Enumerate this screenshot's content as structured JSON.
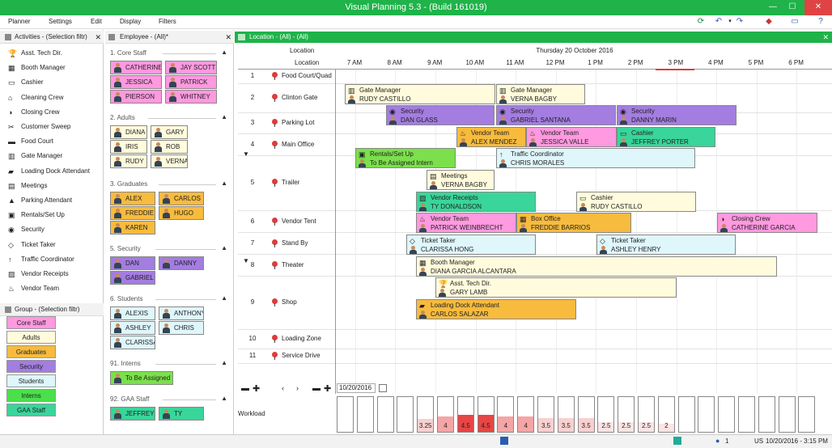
{
  "app": {
    "title": "Visual Planning 5.3 - (Build 161019)"
  },
  "menu": [
    "Planner",
    "Settings",
    "Edit",
    "Display",
    "Filters"
  ],
  "activities": {
    "header": "Activities - (Selection filtr)",
    "items": [
      {
        "label": "Asst. Tech Dir.",
        "icon": "trophy-icon",
        "glyph": "🏆"
      },
      {
        "label": "Booth Manager",
        "icon": "booth-icon",
        "glyph": "▦"
      },
      {
        "label": "Cashier",
        "icon": "cashier-icon",
        "glyph": "▭"
      },
      {
        "label": "Cleaning Crew",
        "icon": "broom-icon",
        "glyph": "⌂"
      },
      {
        "label": "Closing Crew",
        "icon": "closing-icon",
        "glyph": "◑"
      },
      {
        "label": "Customer Sweep",
        "icon": "sweep-icon",
        "glyph": "✂"
      },
      {
        "label": "Food Court",
        "icon": "food-icon",
        "glyph": "▬"
      },
      {
        "label": "Gate Manager",
        "icon": "gate-icon",
        "glyph": "▥"
      },
      {
        "label": "Loading Dock Attendant",
        "icon": "truck-icon",
        "glyph": "▰"
      },
      {
        "label": "Meetings",
        "icon": "meeting-icon",
        "glyph": "▤"
      },
      {
        "label": "Parking Attendant",
        "icon": "cone-icon",
        "glyph": "▲"
      },
      {
        "label": "Rentals/Set Up",
        "icon": "rentals-icon",
        "glyph": "▣"
      },
      {
        "label": "Security",
        "icon": "eye-icon",
        "glyph": "◉"
      },
      {
        "label": "Ticket Taker",
        "icon": "ticket-icon",
        "glyph": "◇"
      },
      {
        "label": "Traffic Coordinator",
        "icon": "traffic-icon",
        "glyph": "↑"
      },
      {
        "label": "Vendor Receipts",
        "icon": "receipt-icon",
        "glyph": "▨"
      },
      {
        "label": "Vendor Team",
        "icon": "vendor-icon",
        "glyph": "♨"
      }
    ]
  },
  "groups": {
    "header": "Group - (Selection filtr)",
    "items": [
      {
        "label": "Core Staff",
        "color": "#ff99e0"
      },
      {
        "label": "Adults",
        "color": "#fffbdc"
      },
      {
        "label": "Graduates",
        "color": "#f7bb3e"
      },
      {
        "label": "Security",
        "color": "#a37de0"
      },
      {
        "label": "Students",
        "color": "#dff6fb"
      },
      {
        "label": "Interns",
        "color": "#4be04b"
      },
      {
        "label": "GAA Staff",
        "color": "#39d59a"
      }
    ]
  },
  "employee": {
    "header": "Employee - (All)*",
    "sections": [
      {
        "title": "1. Core Staff",
        "color": "#ff99e0",
        "people": [
          "CATHERINE",
          "JAY SCOTT",
          "JESSICA",
          "PATRICK",
          "PIERSON",
          "WHITNEY"
        ]
      },
      {
        "title": "2. Adults",
        "color": "#fffbdc",
        "people": [
          "DIANA",
          "GARY",
          "IRIS",
          "ROB",
          "RUDY",
          "VERNA"
        ]
      },
      {
        "title": "3. Graduates",
        "color": "#f7bb3e",
        "people": [
          "ALEX",
          "CARLOS",
          "FREDDIE",
          "HUGO",
          "KAREN"
        ]
      },
      {
        "title": "5. Security",
        "color": "#a37de0",
        "people": [
          "DAN",
          "DANNY",
          "GABRIEL"
        ]
      },
      {
        "title": "6. Students",
        "color": "#dff6fb",
        "people": [
          "ALEXIS",
          "ANTHONY",
          "ASHLEY",
          "CHRIS",
          "CLARISSA"
        ]
      },
      {
        "title": "91. Interns",
        "color": "#7be04b",
        "people": [
          "To Be Assigned"
        ]
      },
      {
        "title": "92. GAA Staff",
        "color": "#39d59a",
        "people": [
          "JEFFREY",
          "TY"
        ]
      }
    ]
  },
  "planner": {
    "header": "Location - (All) - (All)",
    "loc_col": "Location",
    "loc_col2": "Location",
    "date": "Thursday 20 October 2016",
    "hours": [
      "7 AM",
      "8 AM",
      "9 AM",
      "10 AM",
      "11 AM",
      "12 PM",
      "1 PM",
      "2 PM",
      "3 PM",
      "4 PM",
      "5 PM",
      "6 PM"
    ],
    "rows": [
      {
        "n": "1",
        "name": "Food Court/Quad"
      },
      {
        "n": "2",
        "name": "Clinton Gate"
      },
      {
        "n": "3",
        "name": "Parking Lot"
      },
      {
        "n": "4",
        "name": "Main Office"
      },
      {
        "n": "5",
        "name": "Trailer"
      },
      {
        "n": "6",
        "name": "Vendor Tent"
      },
      {
        "n": "7",
        "name": "Stand By"
      },
      {
        "n": "8",
        "name": "Theater"
      },
      {
        "n": "9",
        "name": "Shop"
      },
      {
        "n": "10",
        "name": "Loading Zone"
      },
      {
        "n": "11",
        "name": "Service Drive"
      }
    ],
    "tasks": [
      {
        "title": "Gate Manager",
        "person": "RUDY CASTILLO",
        "icon": "gate-icon",
        "glyph": "▥",
        "color": "#fffbdc"
      },
      {
        "title": "Gate Manager",
        "person": "VERNA BAGBY",
        "icon": "gate-icon",
        "glyph": "▥",
        "color": "#fffbdc"
      },
      {
        "title": "Security",
        "person": "DAN GLASS",
        "icon": "eye-icon",
        "glyph": "◉",
        "color": "#a37de0"
      },
      {
        "title": "Security",
        "person": "GABRIEL SANTANA",
        "icon": "eye-icon",
        "glyph": "◉",
        "color": "#a37de0"
      },
      {
        "title": "Security",
        "person": "DANNY MARIN",
        "icon": "eye-icon",
        "glyph": "◉",
        "color": "#a37de0"
      },
      {
        "title": "Vendor Team",
        "person": "ALEX MENDEZ",
        "icon": "vendor-icon",
        "glyph": "♨",
        "color": "#f7bb3e"
      },
      {
        "title": "Vendor Team",
        "person": "JESSICA VALLE",
        "icon": "vendor-icon",
        "glyph": "♨",
        "color": "#ff99e0"
      },
      {
        "title": "Cashier",
        "person": "JEFFREY PORTER",
        "icon": "cashier-icon",
        "glyph": "▭",
        "color": "#39d59a"
      },
      {
        "title": "Rentals/Set Up",
        "person": "To Be Assigned Intern",
        "icon": "rentals-icon",
        "glyph": "▣",
        "color": "#7be04b"
      },
      {
        "title": "Traffic Coordinator",
        "person": "CHRIS MORALES",
        "icon": "traffic-icon",
        "glyph": "↑",
        "color": "#dff6fb"
      },
      {
        "title": "Meetings",
        "person": "VERNA BAGBY",
        "icon": "meeting-icon",
        "glyph": "▤",
        "color": "#fffbdc"
      },
      {
        "title": "Vendor Receipts",
        "person": "TY DONALDSON",
        "icon": "receipt-icon",
        "glyph": "▨",
        "color": "#39d59a"
      },
      {
        "title": "Cashier",
        "person": "RUDY CASTILLO",
        "icon": "cashier-icon",
        "glyph": "▭",
        "color": "#fffbdc"
      },
      {
        "title": "Vendor Team",
        "person": "PATRICK WEINBRECHT",
        "icon": "vendor-icon",
        "glyph": "♨",
        "color": "#ff99e0"
      },
      {
        "title": "Box Office",
        "person": "FREDDIE BARRIOS",
        "icon": "booth-icon",
        "glyph": "▦",
        "color": "#f7bb3e"
      },
      {
        "title": "Closing Crew",
        "person": "CATHERINE GARCIA",
        "icon": "closing-icon",
        "glyph": "◑",
        "color": "#ff99e0"
      },
      {
        "title": "Ticket Taker",
        "person": "CLARISSA HONG",
        "icon": "ticket-icon",
        "glyph": "◇",
        "color": "#dff6fb"
      },
      {
        "title": "Ticket Taker",
        "person": "ASHLEY HENRY",
        "icon": "ticket-icon",
        "glyph": "◇",
        "color": "#dff6fb"
      },
      {
        "title": "Booth Manager",
        "person": "DIANA GARCIA ALCANTARA",
        "icon": "booth-icon",
        "glyph": "▦",
        "color": "#fffbdc"
      },
      {
        "title": "Asst. Tech Dir.",
        "person": "GARY LAMB",
        "icon": "trophy-icon",
        "glyph": "🏆",
        "color": "#fffbdc"
      },
      {
        "title": "Loading Dock Attendant",
        "person": "CARLOS SALAZAR",
        "icon": "truck-icon",
        "glyph": "▰",
        "color": "#f7bb3e"
      }
    ],
    "nav_date": "10/20/2016",
    "workload_label": "Workload",
    "workload": [
      {
        "v": 0,
        "label": ""
      },
      {
        "v": 0,
        "label": ""
      },
      {
        "v": 0,
        "label": ""
      },
      {
        "v": 0,
        "label": ""
      },
      {
        "v": 3.25,
        "label": "3.25"
      },
      {
        "v": 4,
        "label": "4"
      },
      {
        "v": 4.5,
        "label": "4.5"
      },
      {
        "v": 4.5,
        "label": "4.5"
      },
      {
        "v": 4,
        "label": "4"
      },
      {
        "v": 4,
        "label": "4"
      },
      {
        "v": 3.5,
        "label": "3.5"
      },
      {
        "v": 3.5,
        "label": "3.5"
      },
      {
        "v": 3.5,
        "label": "3.5"
      },
      {
        "v": 2.5,
        "label": "2.5"
      },
      {
        "v": 2.5,
        "label": "2.5"
      },
      {
        "v": 2.5,
        "label": "2.5"
      },
      {
        "v": 2,
        "label": "2"
      },
      {
        "v": 0,
        "label": ""
      },
      {
        "v": 0,
        "label": ""
      },
      {
        "v": 0,
        "label": ""
      },
      {
        "v": 0,
        "label": ""
      },
      {
        "v": 0,
        "label": ""
      },
      {
        "v": 0,
        "label": ""
      },
      {
        "v": 0,
        "label": ""
      }
    ]
  },
  "status": {
    "count": "1",
    "locale": "US",
    "datetime": "10/20/2016 - 3:15 PM"
  }
}
